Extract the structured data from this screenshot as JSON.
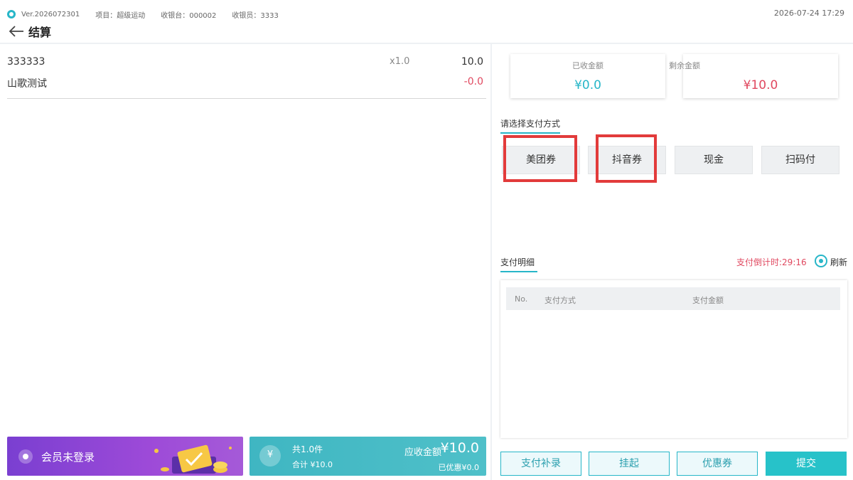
{
  "header": {
    "version": "Ver.2026072301",
    "project": "项目：超级运动",
    "register": "收银台：000002",
    "cashier": "收银员：3333",
    "datetime": "2026-07-24 17:29",
    "title": "结算"
  },
  "order": {
    "items": [
      {
        "name": "333333",
        "qty": "x1.0",
        "price": "10.0"
      },
      {
        "name": "山歌测试",
        "discount": "-0.0"
      }
    ]
  },
  "member_banner": {
    "label": "会员未登录"
  },
  "summary": {
    "count": "共1.0件",
    "total": "合计 ¥10.0",
    "due_label": "应收金额",
    "due_amount": "¥10.0",
    "discount": "已优惠¥0.0"
  },
  "amounts": {
    "received_label": "已收金额",
    "received_value": "¥0.0",
    "remaining_label": "剩余金额",
    "remaining_value": "¥10.0"
  },
  "payment": {
    "title": "请选择支付方式",
    "methods": [
      "美团券",
      "抖音券",
      "现金",
      "扫码付"
    ],
    "highlighted": [
      "美团券",
      "抖音券"
    ],
    "highlight_color": "#e23b3b"
  },
  "detail": {
    "title": "支付明细",
    "countdown": "支付倒计时:29:16",
    "refresh_label": "刷新",
    "columns": [
      "No.",
      "支付方式",
      "支付金额"
    ]
  },
  "actions": {
    "supplement": "支付补录",
    "hold": "挂起",
    "coupon": "优惠券",
    "submit": "提交"
  },
  "colors": {
    "accent": "#27b6c8",
    "danger": "#e0485f",
    "member_gradient_start": "#7a3fd1",
    "summary_gradient_start": "#3fb6c2"
  }
}
